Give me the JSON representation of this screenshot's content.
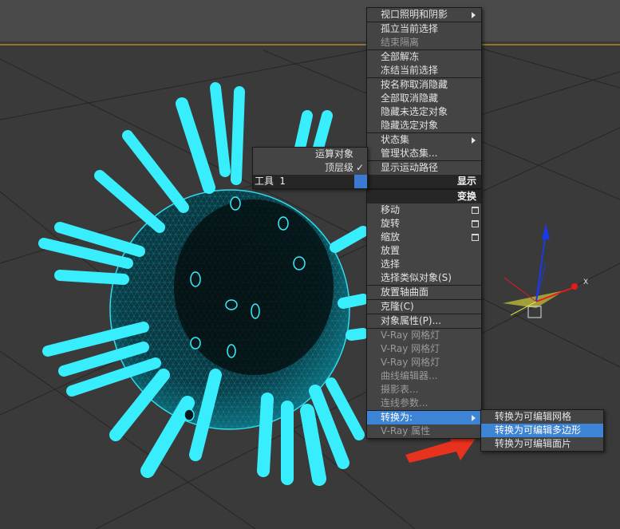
{
  "quad_upper_right": {
    "items": [
      {
        "label": "视口照明和阴影",
        "disabled": false,
        "submenu": true,
        "sep_before": false
      },
      {
        "label": "孤立当前选择",
        "disabled": false,
        "sep_before": true
      },
      {
        "label": "结束隔离",
        "disabled": true,
        "sep_before": false
      },
      {
        "label": "全部解冻",
        "disabled": false,
        "sep_before": true
      },
      {
        "label": "冻结当前选择",
        "disabled": false,
        "sep_before": false
      },
      {
        "label": "按名称取消隐藏",
        "disabled": false,
        "sep_before": true
      },
      {
        "label": "全部取消隐藏",
        "disabled": false,
        "sep_before": false
      },
      {
        "label": "隐藏未选定对象",
        "disabled": false,
        "sep_before": false
      },
      {
        "label": "隐藏选定对象",
        "disabled": false,
        "sep_before": false
      },
      {
        "label": "状态集",
        "disabled": false,
        "submenu": true,
        "sep_before": true
      },
      {
        "label": "管理状态集...",
        "disabled": false,
        "sep_before": false
      },
      {
        "label": "显示运动路径",
        "disabled": false,
        "sep_before": true
      }
    ],
    "header": "显示"
  },
  "quad_lower_right": {
    "header": "变换",
    "items": [
      {
        "label": "移动",
        "icon": true
      },
      {
        "label": "旋转",
        "icon": true
      },
      {
        "label": "缩放",
        "icon": true
      },
      {
        "label": "放置"
      },
      {
        "label": "选择"
      },
      {
        "label": "选择类似对象(S)"
      },
      {
        "label": "放置轴曲面",
        "sep_before": true
      },
      {
        "label": "克隆(C)",
        "sep_before": true
      },
      {
        "label": "对象属性(P)...",
        "sep_before": true
      },
      {
        "label": "V-Ray 网格灯",
        "disabled": true,
        "sep_before": true
      },
      {
        "label": "V-Ray 网格灯",
        "disabled": true
      },
      {
        "label": "V-Ray 网格灯",
        "disabled": true
      },
      {
        "label": "曲线编辑器...",
        "disabled": true
      },
      {
        "label": "摄影表...",
        "disabled": true
      },
      {
        "label": "连线参数...",
        "disabled": true
      },
      {
        "label": "转换为:",
        "highlight": true,
        "submenu": true,
        "sep_before": true
      },
      {
        "label": "V-Ray 属性",
        "disabled": true
      }
    ]
  },
  "quad_left": {
    "items": [
      {
        "label": "运算对象"
      },
      {
        "label": "顶层级",
        "checked": true
      }
    ],
    "header": "工具 1",
    "check_glyph": "✓"
  },
  "convert_submenu": {
    "items": [
      {
        "label": "转换为可编辑网格",
        "highlight": false
      },
      {
        "label": "转换为可编辑多边形",
        "highlight": true
      },
      {
        "label": "转换为可编辑面片",
        "highlight": false
      }
    ]
  },
  "gizmo": {
    "x_label": "X"
  }
}
